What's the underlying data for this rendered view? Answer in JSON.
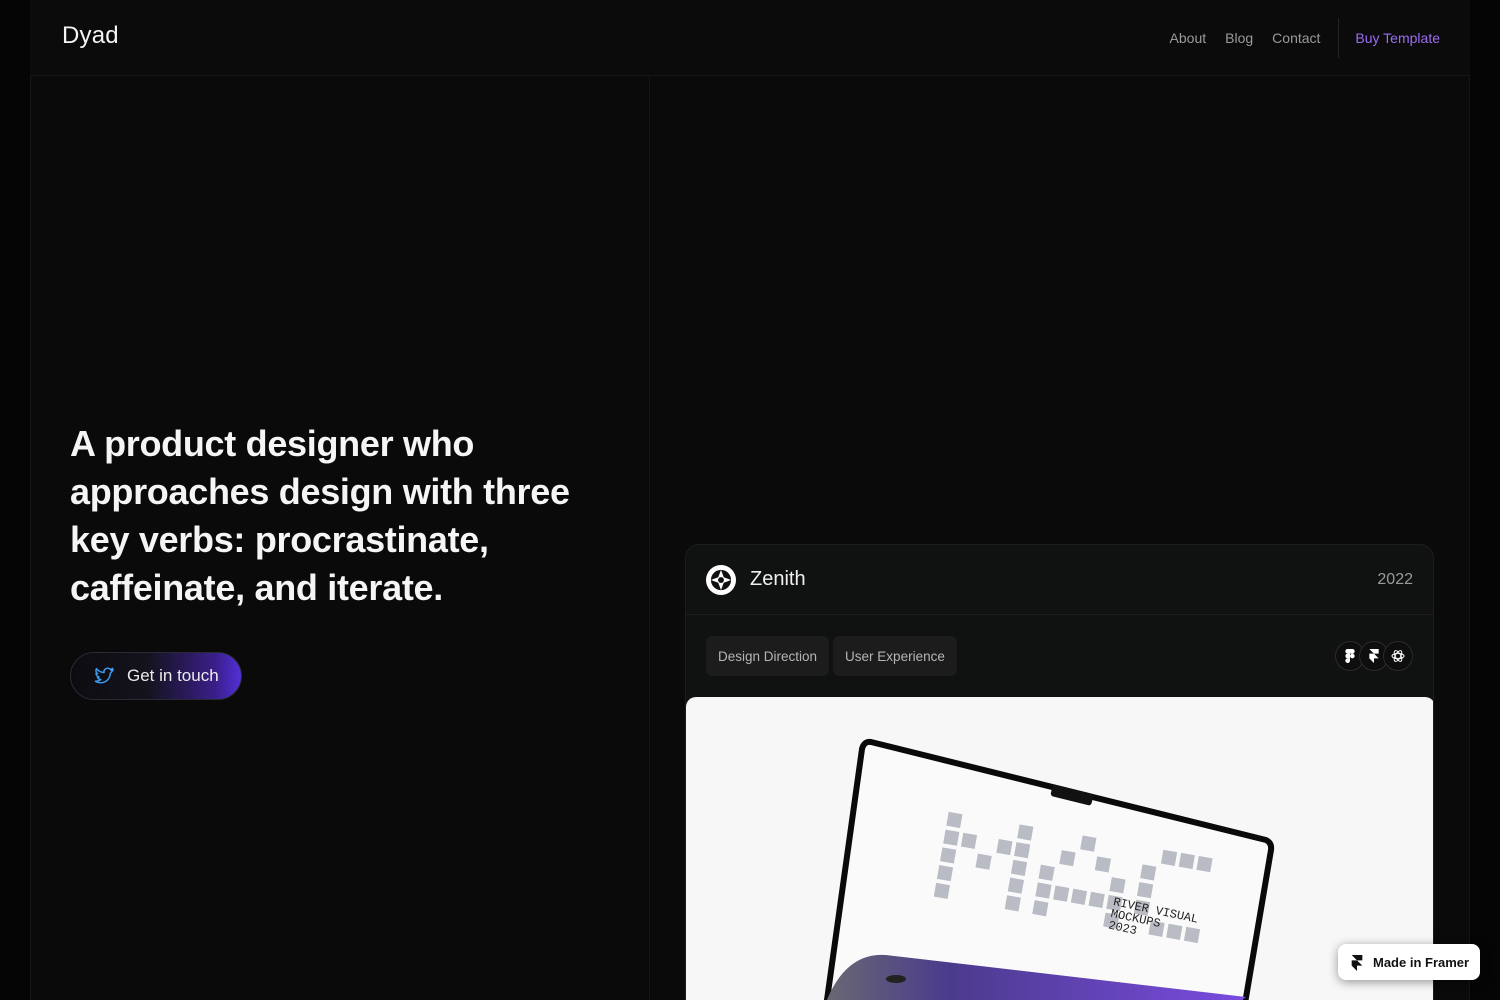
{
  "nav": {
    "logo": "Dyad",
    "links": [
      "About",
      "Blog",
      "Contact"
    ],
    "cta": "Buy Template"
  },
  "hero": {
    "headline": "A product designer who approaches design with three key verbs: procrastinate, caffeinate, and iterate.",
    "cta_label": "Get in touch",
    "cta_icon": "twitter-bird-icon"
  },
  "project": {
    "title": "Zenith",
    "year": "2022",
    "tags": [
      "Design Direction",
      "User Experience"
    ],
    "tools": [
      "figma-icon",
      "framer-icon",
      "openai-icon"
    ],
    "image": {
      "screen_text": "MAC",
      "caption_lines": [
        "RIVER VISUAL",
        "MOCKUPS",
        "2023"
      ]
    }
  },
  "badge": {
    "label": "Made in Framer",
    "icon": "framer-icon"
  },
  "colors": {
    "accent": "#9b6cf2",
    "background": "#0a0a0a"
  }
}
